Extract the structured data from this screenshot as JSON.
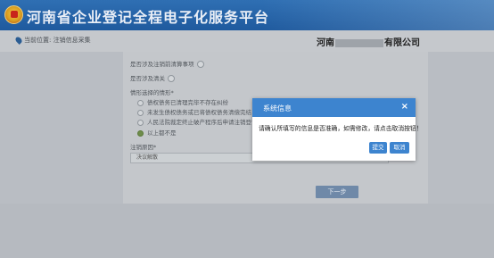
{
  "header": {
    "title": "河南省企业登记全程电子化服务平台",
    "emblem_icon": "national-emblem-icon"
  },
  "breadcrumb": {
    "text": "当前位置: 注销信息采集",
    "company_prefix": "河南",
    "company_suffix": "有限公司"
  },
  "form": {
    "q1_label": "是否涉及注销前清算事项",
    "q2_label": "是否涉及清关",
    "q3_label": "情形选择的情形*",
    "options": [
      "债权债务已清理完毕不存在纠纷",
      "未发生债权债务或已将债权债务清偿完结",
      "人民法院裁定终止破产程序后申请注销登记",
      "以上都不是"
    ],
    "checked_index": 3,
    "reason_label": "注销原因*",
    "reason_value": "决议解散",
    "next_label": "下一步"
  },
  "modal": {
    "title": "系统信息",
    "close_label": "×",
    "message": "请确认所填写的信息是否准确，如需修改，请点击取消按钮！",
    "submit_label": "提交",
    "cancel_label": "取消"
  },
  "colors": {
    "primary": "#3d84cf",
    "header": "#2f6fb3",
    "overlay_bg": "#b9bdc3"
  }
}
